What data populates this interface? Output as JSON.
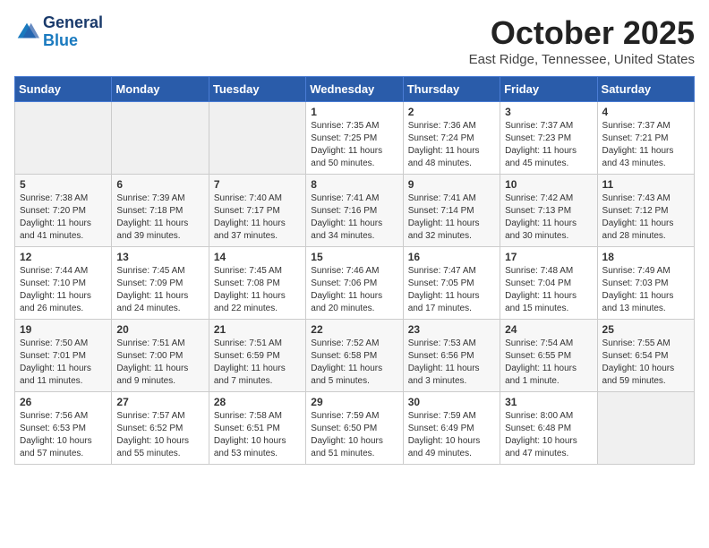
{
  "header": {
    "logo_line1": "General",
    "logo_line2": "Blue",
    "month": "October 2025",
    "location": "East Ridge, Tennessee, United States"
  },
  "weekdays": [
    "Sunday",
    "Monday",
    "Tuesday",
    "Wednesday",
    "Thursday",
    "Friday",
    "Saturday"
  ],
  "weeks": [
    [
      {
        "day": "",
        "info": ""
      },
      {
        "day": "",
        "info": ""
      },
      {
        "day": "",
        "info": ""
      },
      {
        "day": "1",
        "info": "Sunrise: 7:35 AM\nSunset: 7:25 PM\nDaylight: 11 hours\nand 50 minutes."
      },
      {
        "day": "2",
        "info": "Sunrise: 7:36 AM\nSunset: 7:24 PM\nDaylight: 11 hours\nand 48 minutes."
      },
      {
        "day": "3",
        "info": "Sunrise: 7:37 AM\nSunset: 7:23 PM\nDaylight: 11 hours\nand 45 minutes."
      },
      {
        "day": "4",
        "info": "Sunrise: 7:37 AM\nSunset: 7:21 PM\nDaylight: 11 hours\nand 43 minutes."
      }
    ],
    [
      {
        "day": "5",
        "info": "Sunrise: 7:38 AM\nSunset: 7:20 PM\nDaylight: 11 hours\nand 41 minutes."
      },
      {
        "day": "6",
        "info": "Sunrise: 7:39 AM\nSunset: 7:18 PM\nDaylight: 11 hours\nand 39 minutes."
      },
      {
        "day": "7",
        "info": "Sunrise: 7:40 AM\nSunset: 7:17 PM\nDaylight: 11 hours\nand 37 minutes."
      },
      {
        "day": "8",
        "info": "Sunrise: 7:41 AM\nSunset: 7:16 PM\nDaylight: 11 hours\nand 34 minutes."
      },
      {
        "day": "9",
        "info": "Sunrise: 7:41 AM\nSunset: 7:14 PM\nDaylight: 11 hours\nand 32 minutes."
      },
      {
        "day": "10",
        "info": "Sunrise: 7:42 AM\nSunset: 7:13 PM\nDaylight: 11 hours\nand 30 minutes."
      },
      {
        "day": "11",
        "info": "Sunrise: 7:43 AM\nSunset: 7:12 PM\nDaylight: 11 hours\nand 28 minutes."
      }
    ],
    [
      {
        "day": "12",
        "info": "Sunrise: 7:44 AM\nSunset: 7:10 PM\nDaylight: 11 hours\nand 26 minutes."
      },
      {
        "day": "13",
        "info": "Sunrise: 7:45 AM\nSunset: 7:09 PM\nDaylight: 11 hours\nand 24 minutes."
      },
      {
        "day": "14",
        "info": "Sunrise: 7:45 AM\nSunset: 7:08 PM\nDaylight: 11 hours\nand 22 minutes."
      },
      {
        "day": "15",
        "info": "Sunrise: 7:46 AM\nSunset: 7:06 PM\nDaylight: 11 hours\nand 20 minutes."
      },
      {
        "day": "16",
        "info": "Sunrise: 7:47 AM\nSunset: 7:05 PM\nDaylight: 11 hours\nand 17 minutes."
      },
      {
        "day": "17",
        "info": "Sunrise: 7:48 AM\nSunset: 7:04 PM\nDaylight: 11 hours\nand 15 minutes."
      },
      {
        "day": "18",
        "info": "Sunrise: 7:49 AM\nSunset: 7:03 PM\nDaylight: 11 hours\nand 13 minutes."
      }
    ],
    [
      {
        "day": "19",
        "info": "Sunrise: 7:50 AM\nSunset: 7:01 PM\nDaylight: 11 hours\nand 11 minutes."
      },
      {
        "day": "20",
        "info": "Sunrise: 7:51 AM\nSunset: 7:00 PM\nDaylight: 11 hours\nand 9 minutes."
      },
      {
        "day": "21",
        "info": "Sunrise: 7:51 AM\nSunset: 6:59 PM\nDaylight: 11 hours\nand 7 minutes."
      },
      {
        "day": "22",
        "info": "Sunrise: 7:52 AM\nSunset: 6:58 PM\nDaylight: 11 hours\nand 5 minutes."
      },
      {
        "day": "23",
        "info": "Sunrise: 7:53 AM\nSunset: 6:56 PM\nDaylight: 11 hours\nand 3 minutes."
      },
      {
        "day": "24",
        "info": "Sunrise: 7:54 AM\nSunset: 6:55 PM\nDaylight: 11 hours\nand 1 minute."
      },
      {
        "day": "25",
        "info": "Sunrise: 7:55 AM\nSunset: 6:54 PM\nDaylight: 10 hours\nand 59 minutes."
      }
    ],
    [
      {
        "day": "26",
        "info": "Sunrise: 7:56 AM\nSunset: 6:53 PM\nDaylight: 10 hours\nand 57 minutes."
      },
      {
        "day": "27",
        "info": "Sunrise: 7:57 AM\nSunset: 6:52 PM\nDaylight: 10 hours\nand 55 minutes."
      },
      {
        "day": "28",
        "info": "Sunrise: 7:58 AM\nSunset: 6:51 PM\nDaylight: 10 hours\nand 53 minutes."
      },
      {
        "day": "29",
        "info": "Sunrise: 7:59 AM\nSunset: 6:50 PM\nDaylight: 10 hours\nand 51 minutes."
      },
      {
        "day": "30",
        "info": "Sunrise: 7:59 AM\nSunset: 6:49 PM\nDaylight: 10 hours\nand 49 minutes."
      },
      {
        "day": "31",
        "info": "Sunrise: 8:00 AM\nSunset: 6:48 PM\nDaylight: 10 hours\nand 47 minutes."
      },
      {
        "day": "",
        "info": ""
      }
    ]
  ]
}
